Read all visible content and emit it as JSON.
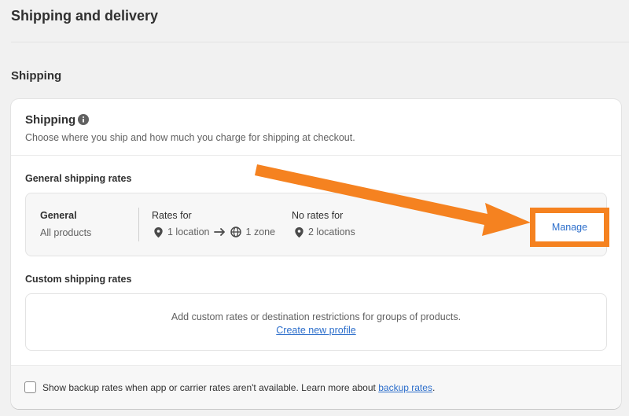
{
  "page": {
    "title": "Shipping and delivery"
  },
  "section": {
    "title": "Shipping"
  },
  "card": {
    "title": "Shipping",
    "info_icon": "info-icon",
    "subtitle": "Choose where you ship and how much you charge for shipping at checkout."
  },
  "general_rates": {
    "heading": "General shipping rates",
    "profile_name": "General",
    "products": "All products",
    "rates_for_label": "Rates for",
    "rates_locations": "1 location",
    "rates_zones": "1 zone",
    "no_rates_label": "No rates for",
    "no_rates_locations": "2 locations",
    "manage_label": "Manage"
  },
  "custom_rates": {
    "heading": "Custom shipping rates",
    "description": "Add custom rates or destination restrictions for groups of products.",
    "link": "Create new profile"
  },
  "footer": {
    "checkbox_checked": false,
    "text": "Show backup rates when app or carrier rates aren't available. Learn more about",
    "link": "backup rates",
    "suffix": "."
  },
  "colors": {
    "accent_orange": "#f58220",
    "link_blue": "#2c6ecb"
  }
}
